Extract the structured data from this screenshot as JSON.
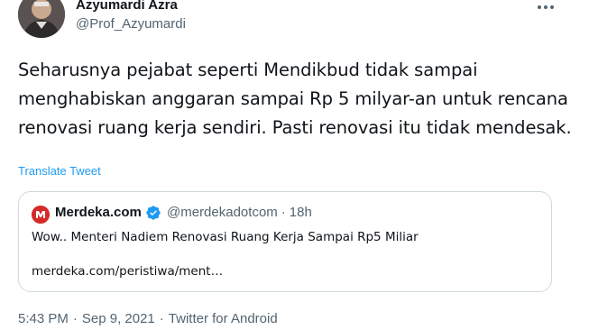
{
  "author": {
    "display_name": "Azyumardi Azra",
    "handle": "@Prof_Azyumardi"
  },
  "tweet": {
    "text": "Seharusnya pejabat seperti Mendikbud tidak sampai menghabiskan anggaran sampai Rp 5 milyar-an untuk rencana renovasi ruang kerja sendiri. Pasti renovasi itu tidak mendesak.",
    "translate_label": "Translate Tweet"
  },
  "quoted": {
    "name": "Merdeka.com",
    "handle": "@merdekadotcom",
    "separator": "·",
    "age": "18h",
    "text": "Wow.. Menteri Nadiem Renovasi Ruang Kerja Sampai Rp5 Miliar",
    "link": "merdeka.com/peristiwa/ment…",
    "logo_color": "#d42a2a"
  },
  "meta": {
    "time": "5:43 PM",
    "separator": "·",
    "date": "Sep 9, 2021",
    "source": "Twitter for Android"
  },
  "icons": {
    "more": "more-horizontal-icon",
    "verified": "verified-badge-icon",
    "logo": "merdeka-logo-icon"
  },
  "colors": {
    "accent": "#1d9bf0",
    "text_primary": "#0f1419",
    "text_secondary": "#536471",
    "border": "#cfd9de"
  }
}
